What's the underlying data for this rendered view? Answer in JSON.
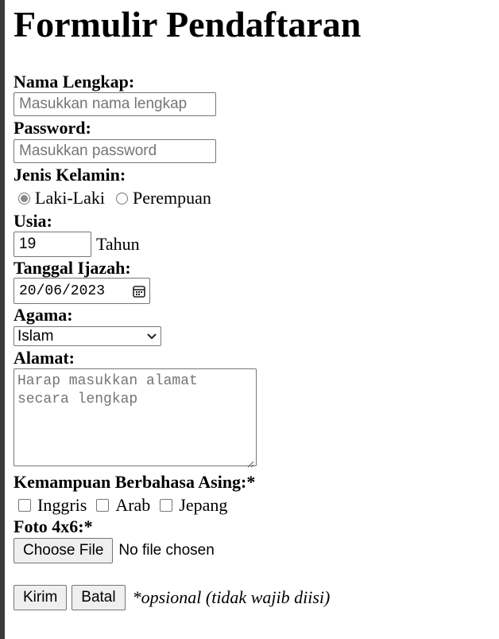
{
  "form": {
    "title": "Formulir Pendaftaran",
    "nama": {
      "label": "Nama Lengkap:",
      "placeholder": "Masukkan nama lengkap"
    },
    "password": {
      "label": "Password:",
      "placeholder": "Masukkan password"
    },
    "gender": {
      "label": "Jenis Kelamin:",
      "options": [
        "Laki-Laki",
        "Perempuan"
      ],
      "selected": "Laki-Laki"
    },
    "usia": {
      "label": "Usia:",
      "value": "19",
      "unit": "Tahun"
    },
    "tanggal": {
      "label": "Tanggal Ijazah:",
      "value": "20/06/2023"
    },
    "agama": {
      "label": "Agama:",
      "selected": "Islam"
    },
    "alamat": {
      "label": "Alamat:",
      "placeholder": "Harap masukkan alamat secara lengkap"
    },
    "bahasa": {
      "label": "Kemampuan Berbahasa Asing:*",
      "options": [
        "Inggris",
        "Arab",
        "Jepang"
      ]
    },
    "foto": {
      "label": "Foto 4x6:*",
      "button_label": "Choose File",
      "status": "No file chosen"
    },
    "submit_label": "Kirim",
    "reset_label": "Batal",
    "note": "*opsional (tidak wajib diisi)"
  },
  "icons": {
    "calendar": "calendar-icon",
    "dropdown": "chevron-down-icon",
    "resize": "resize-grip-icon"
  }
}
